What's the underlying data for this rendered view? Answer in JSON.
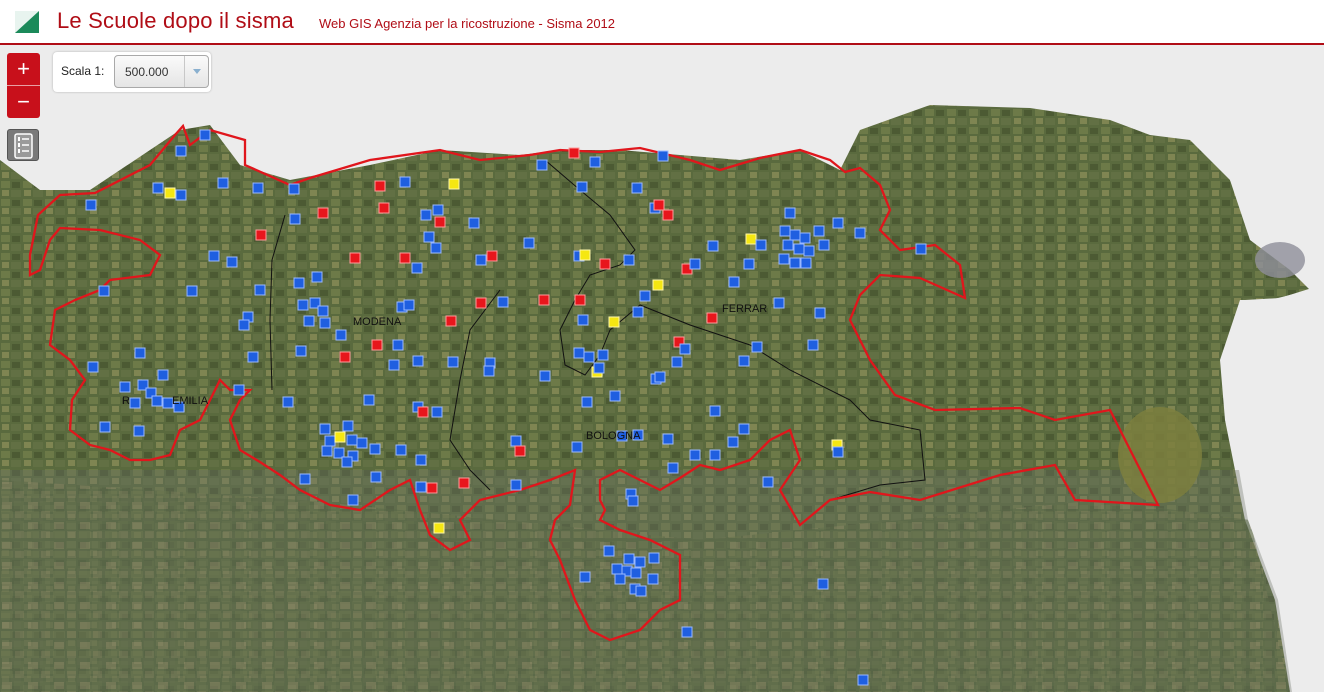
{
  "header": {
    "title": "Le Scuole dopo il sisma",
    "subtitle": "Web GIS Agenzia per la ricostruzione - Sisma 2012"
  },
  "controls": {
    "zoom_in": "+",
    "zoom_out": "−",
    "scale_label": "Scala 1:",
    "scale_value": "500.000",
    "tool_icon": "legend-icon"
  },
  "map": {
    "labels": {
      "modena": "MODENA",
      "ferrara": "FERRAR",
      "bologna": "BOLOGNA",
      "emilia_prefix": "R",
      "emilia": "EMILIA"
    }
  },
  "colors": {
    "brand": "#b00d16",
    "boundary": "#e0161c",
    "school_blue": "#1f5fe0",
    "school_red": "#e8161c",
    "school_yellow": "#f5e712"
  }
}
